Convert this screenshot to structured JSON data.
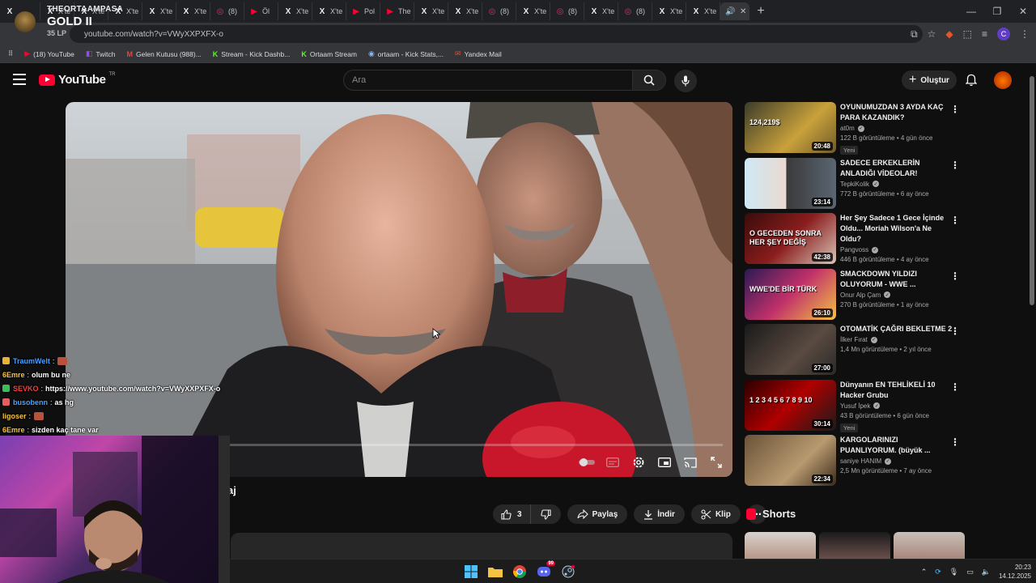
{
  "stream": {
    "channel": "THEORTAAMPASA",
    "rank": "GOLD II",
    "lp": "35 LP"
  },
  "browser": {
    "tabs": [
      {
        "icon": "x",
        "label": "X'te"
      },
      {
        "icon": "x",
        "label": "X'te"
      },
      {
        "icon": "x",
        "label": "X'te"
      },
      {
        "icon": "x",
        "label": "X'te"
      },
      {
        "icon": "x",
        "label": "X'te"
      },
      {
        "icon": "ig",
        "label": "(8)"
      },
      {
        "icon": "yt",
        "label": "Öl"
      },
      {
        "icon": "x",
        "label": "X'te"
      },
      {
        "icon": "x",
        "label": "X'te"
      },
      {
        "icon": "yt",
        "label": "Pol"
      },
      {
        "icon": "yt",
        "label": "The"
      },
      {
        "icon": "x",
        "label": "X'te"
      },
      {
        "icon": "x",
        "label": "X'te"
      },
      {
        "icon": "ig",
        "label": "(8)"
      },
      {
        "icon": "x",
        "label": "X'te"
      },
      {
        "icon": "ig",
        "label": "(8)"
      },
      {
        "icon": "x",
        "label": "X'te"
      },
      {
        "icon": "ig",
        "label": "(8)"
      },
      {
        "icon": "x",
        "label": "X'te"
      },
      {
        "icon": "x",
        "label": "X'te"
      }
    ],
    "url": "youtube.com/watch?v=VWyXXPXFX-o",
    "profile_initial": "C",
    "bookmarks": [
      {
        "icon": "youtube",
        "label": "(18) YouTube"
      },
      {
        "icon": "twitch",
        "label": "Twitch"
      },
      {
        "icon": "gmail",
        "label": "Gelen Kutusu (988)..."
      },
      {
        "icon": "kick",
        "label": "Stream - Kick Dashb..."
      },
      {
        "icon": "kick",
        "label": "Ortaam Stream"
      },
      {
        "icon": "stats",
        "label": "ortaam - Kick Stats,..."
      },
      {
        "icon": "yandex",
        "label": "Yandex Mail"
      }
    ]
  },
  "youtube": {
    "logo_text": "YouTube",
    "logo_region": "TR",
    "search_placeholder": "Ara",
    "create_label": "Oluştur",
    "video_title_partial": "aj",
    "likes": "3",
    "share_label": "Paylaş",
    "download_label": "İndir",
    "clip_label": "Klip",
    "shorts_label": "Shorts",
    "recommendations": [
      {
        "title": "OYUNUMUZDAN 3 AYDA KAÇ PARA KAZANDIK?",
        "channel": "at0m",
        "views": "122 B görüntüleme",
        "age": "4 gün önce",
        "duration": "20:48",
        "badge": "Yeni",
        "thumb_text": "124,219$"
      },
      {
        "title": "SADECE ERKEKLERİN ANLADIĞI VİDEOLAR!",
        "channel": "TepkiKolik",
        "views": "772 B görüntüleme",
        "age": "6 ay önce",
        "duration": "23:14",
        "badge": "",
        "thumb_text": ""
      },
      {
        "title": "Her Şey Sadece 1 Gece İçinde Oldu... Moriah Wilson'a Ne Oldu?",
        "channel": "Pangvoss",
        "views": "446 B görüntüleme",
        "age": "4 ay önce",
        "duration": "42:38",
        "badge": "",
        "thumb_text": "O GECEDEN SONRA HER ŞEY DEĞİŞ"
      },
      {
        "title": "SMACKDOWN YILDIZI OLUYORUM - WWE ...",
        "channel": "Onur Alp Çam",
        "views": "270 B görüntüleme",
        "age": "1 ay önce",
        "duration": "26:10",
        "badge": "",
        "thumb_text": "WWE'DE BİR TÜRK"
      },
      {
        "title": "OTOMATİK ÇAĞRI BEKLETME 2",
        "channel": "İlker Fırat",
        "views": "1,4 Mn görüntüleme",
        "age": "2 yıl önce",
        "duration": "27:00",
        "badge": "",
        "thumb_text": ""
      },
      {
        "title": "Dünyanın EN TEHLİKELİ 10 Hacker Grubu",
        "channel": "Yusuf İpek",
        "views": "43 B görüntüleme",
        "age": "6 gün önce",
        "duration": "30:14",
        "badge": "Yeni",
        "thumb_text": "1 2 3 4 5 6 7 8 9 10"
      },
      {
        "title": "KARGOLARINIZI PUANLIYORUM. (büyük ...",
        "channel": "saniye HANIM",
        "views": "2,5 Mn görüntüleme",
        "age": "7 ay önce",
        "duration": "22:34",
        "badge": "",
        "thumb_text": ""
      }
    ]
  },
  "chat": [
    {
      "user": "TraumWelt",
      "sep": ":",
      "text": "",
      "color": "#4aa3ff",
      "badge": "#e8b339",
      "emote": true
    },
    {
      "user": "6Emre",
      "sep": ":",
      "text": "olum bu ne",
      "color": "#f5c542",
      "badge": "",
      "emote": false
    },
    {
      "user": "SEVKO",
      "sep": ":",
      "text": "https://www.youtube.com/watch?v=VWyXXPXFX-o",
      "color": "#ff3b3b",
      "badge": "#3dbd5a",
      "emote": false
    },
    {
      "user": "busobenn",
      "sep": ":",
      "text": "as hg",
      "color": "#4aa3ff",
      "badge": "#e85d5d",
      "emote": false
    },
    {
      "user": "ligoser",
      "sep": ":",
      "text": "",
      "color": "#f5c542",
      "badge": "",
      "emote": true
    },
    {
      "user": "6Emre",
      "sep": ":",
      "text": "sizden kaç tane var",
      "color": "#f5c542",
      "badge": "",
      "emote": false
    }
  ],
  "taskbar": {
    "time": "20:23",
    "date": "14.12.2025",
    "discord_badge": "99"
  },
  "colors": {
    "yt_bg": "#0f0f0f",
    "yt_red": "#ff0033",
    "chrome_bg": "#202124",
    "surface": "#272727"
  }
}
